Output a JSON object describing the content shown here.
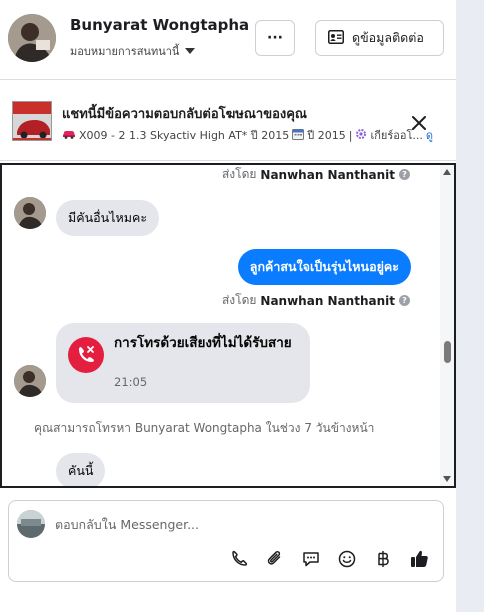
{
  "header": {
    "contact_name": "Bunyarat Wongtapha",
    "assign_label": "มอบหมายการสนทนานี้",
    "more_label": "···",
    "contact_info_label": "ดูข้อมูลติดต่อ"
  },
  "ad_context": {
    "title": "แชทนี้มีข้อความตอบกลับต่อโฆษณาของคุณ",
    "car_model": "X009 - 2 1.3 Skyactiv High AT* ปี 2015",
    "year": "ปี 2015",
    "gear": "เกียร์ออโ...",
    "link": "ดู",
    "separator": "|"
  },
  "messages": {
    "sent_by_prefix": "ส่งโดย",
    "sent_by_name": "Nanwhan Nanthanit",
    "incoming_1": "มีคันอื่นไหมคะ",
    "outgoing_1": "ลูกค้าสนใจเป็นรุ่นไหนอยู่คะ",
    "missed_call_title": "การโทรด้วยเสียงที่ไม่ได้รับสาย",
    "missed_call_time": "21:05",
    "call_notice": "คุณสามารถโทรหา Bunyarat Wongtapha ในช่วง 7 วันข้างหน้า",
    "incoming_2": "คันนี้"
  },
  "composer": {
    "placeholder": "ตอบกลับใน Messenger..."
  },
  "icons": {
    "phone": "phone-icon",
    "attach": "paperclip-icon",
    "quick_reply": "chat-bubble-icon",
    "emoji": "emoji-icon",
    "payment": "baht-icon",
    "like": "thumbs-up-icon"
  },
  "colors": {
    "accent": "#0a7cff",
    "missed_call": "#e41e3f",
    "incoming_bubble": "#e4e6eb"
  }
}
